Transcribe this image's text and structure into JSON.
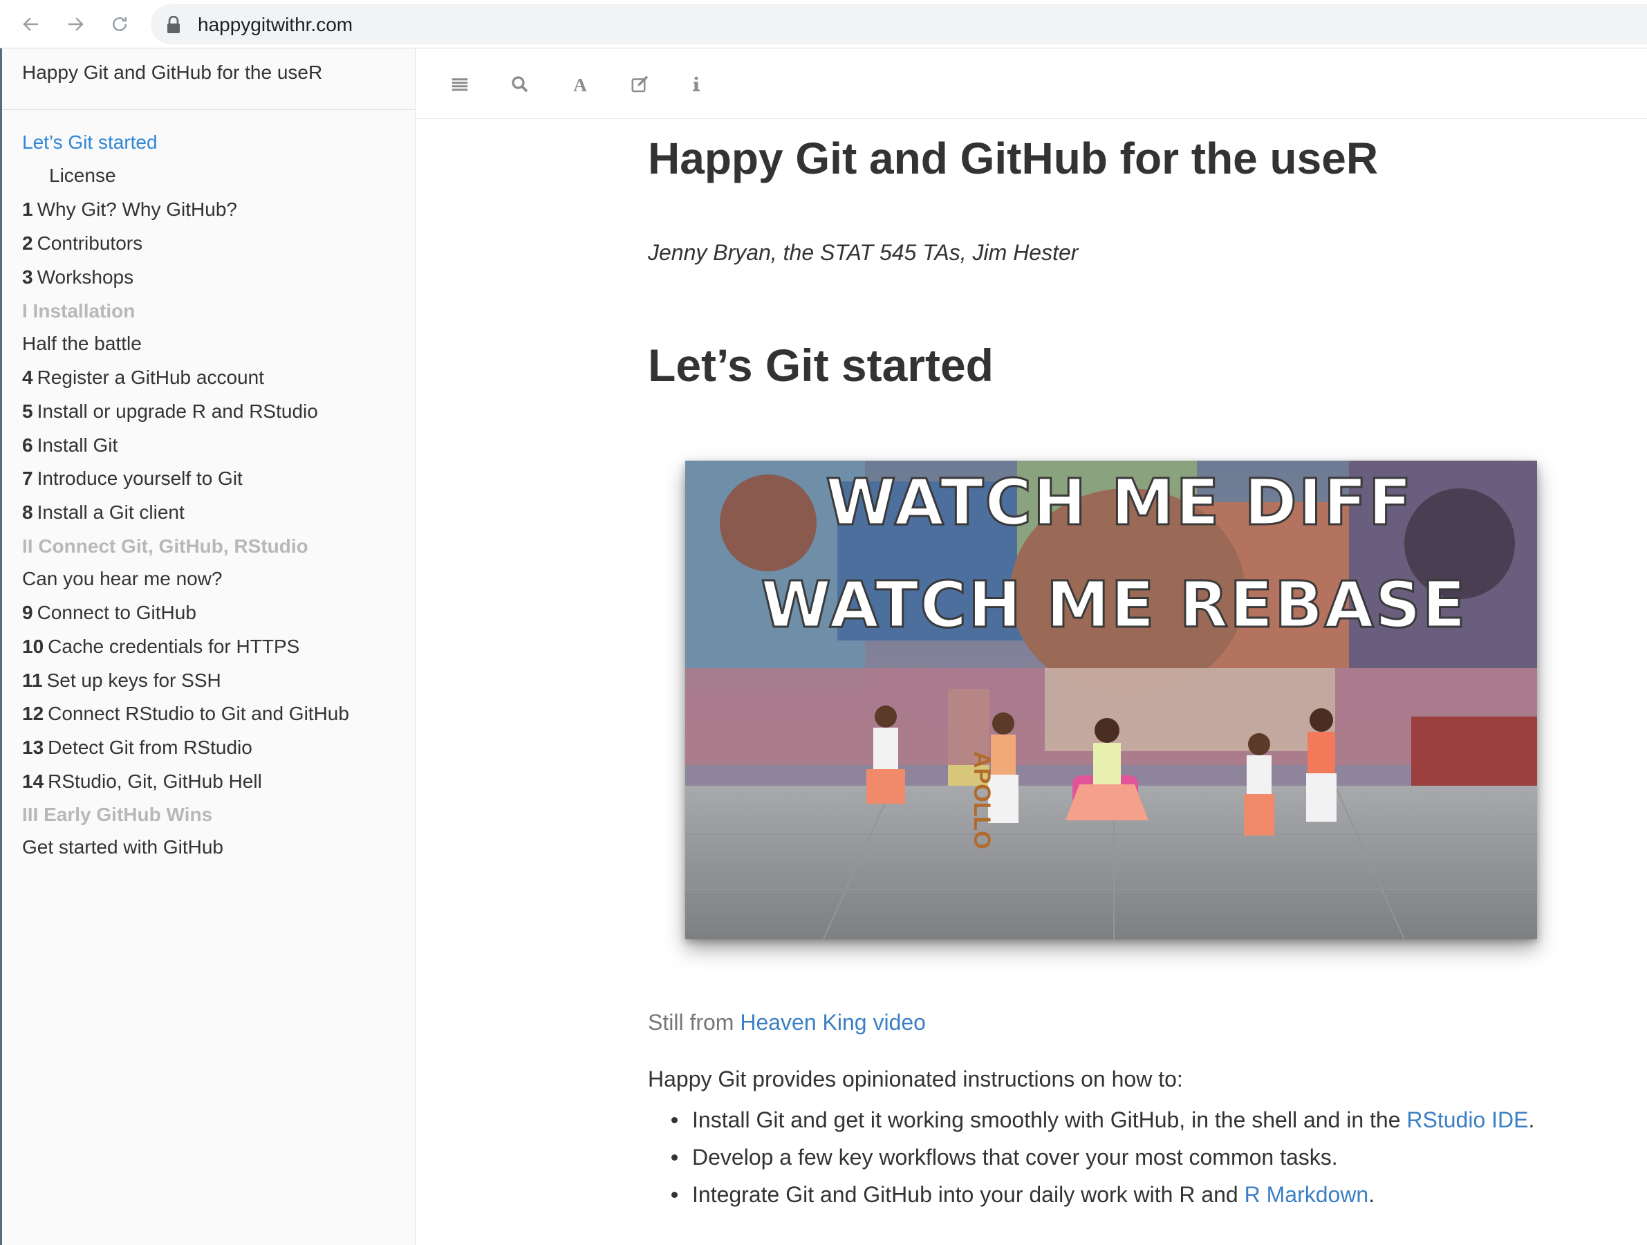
{
  "browser": {
    "url": "happygitwithr.com",
    "icons": [
      "back-arrow-icon",
      "forward-arrow-icon",
      "reload-icon",
      "lock-icon"
    ]
  },
  "sidebar": {
    "title": "Happy Git and GitHub for the useR",
    "items": [
      {
        "num": "",
        "label": "Let’s Git started",
        "kind": "active"
      },
      {
        "num": "",
        "label": "License",
        "kind": "sub"
      },
      {
        "num": "1",
        "label": "Why Git? Why GitHub?",
        "kind": "chapter"
      },
      {
        "num": "2",
        "label": "Contributors",
        "kind": "chapter"
      },
      {
        "num": "3",
        "label": "Workshops",
        "kind": "chapter"
      },
      {
        "num": "",
        "label": "I Installation",
        "kind": "part"
      },
      {
        "num": "",
        "label": "Half the battle",
        "kind": "chapter"
      },
      {
        "num": "4",
        "label": "Register a GitHub account",
        "kind": "chapter"
      },
      {
        "num": "5",
        "label": "Install or upgrade R and RStudio",
        "kind": "chapter"
      },
      {
        "num": "6",
        "label": "Install Git",
        "kind": "chapter"
      },
      {
        "num": "7",
        "label": "Introduce yourself to Git",
        "kind": "chapter"
      },
      {
        "num": "8",
        "label": "Install a Git client",
        "kind": "chapter"
      },
      {
        "num": "",
        "label": "II Connect Git, GitHub, RStudio",
        "kind": "part"
      },
      {
        "num": "",
        "label": "Can you hear me now?",
        "kind": "chapter"
      },
      {
        "num": "9",
        "label": "Connect to GitHub",
        "kind": "chapter"
      },
      {
        "num": "10",
        "label": "Cache credentials for HTTPS",
        "kind": "chapter"
      },
      {
        "num": "11",
        "label": "Set up keys for SSH",
        "kind": "chapter"
      },
      {
        "num": "12",
        "label": "Connect RStudio to Git and GitHub",
        "kind": "chapter"
      },
      {
        "num": "13",
        "label": "Detect Git from RStudio",
        "kind": "chapter"
      },
      {
        "num": "14",
        "label": "RStudio, Git, GitHub Hell",
        "kind": "chapter"
      },
      {
        "num": "",
        "label": "III Early GitHub Wins",
        "kind": "part"
      },
      {
        "num": "",
        "label": "Get started with GitHub",
        "kind": "chapter"
      }
    ]
  },
  "toolbar": {
    "icons": [
      "toggle-sidebar-icon",
      "search-icon",
      "font-settings-icon",
      "edit-icon",
      "info-icon"
    ]
  },
  "main": {
    "title": "Happy Git and GitHub for the useR",
    "authors": "Jenny Bryan, the STAT 545 TAs, Jim Hester",
    "chapter_title": "Let’s Git started",
    "hero": {
      "line1": "WATCH ME DIFF",
      "line2": "WATCH ME REBASE",
      "mural_text": "APOLLO"
    },
    "caption_prefix": "Still from ",
    "caption_link": "Heaven King video",
    "intro": "Happy Git provides opinionated instructions on how to:",
    "bullets": [
      {
        "before": "Install Git and get it working smoothly with GitHub, in the shell and in the ",
        "link": "RStudio IDE",
        "after": "."
      },
      {
        "before": "Develop a few key workflows that cover your most common tasks.",
        "link": "",
        "after": ""
      },
      {
        "before": "Integrate Git and GitHub into your daily work with R and ",
        "link": "R Markdown",
        "after": "."
      }
    ]
  },
  "colors": {
    "link": "#3b7fc4",
    "active_toc": "#2f86d6",
    "part_heading": "#b8b8b8",
    "sidebar_bg": "#fafafa"
  }
}
